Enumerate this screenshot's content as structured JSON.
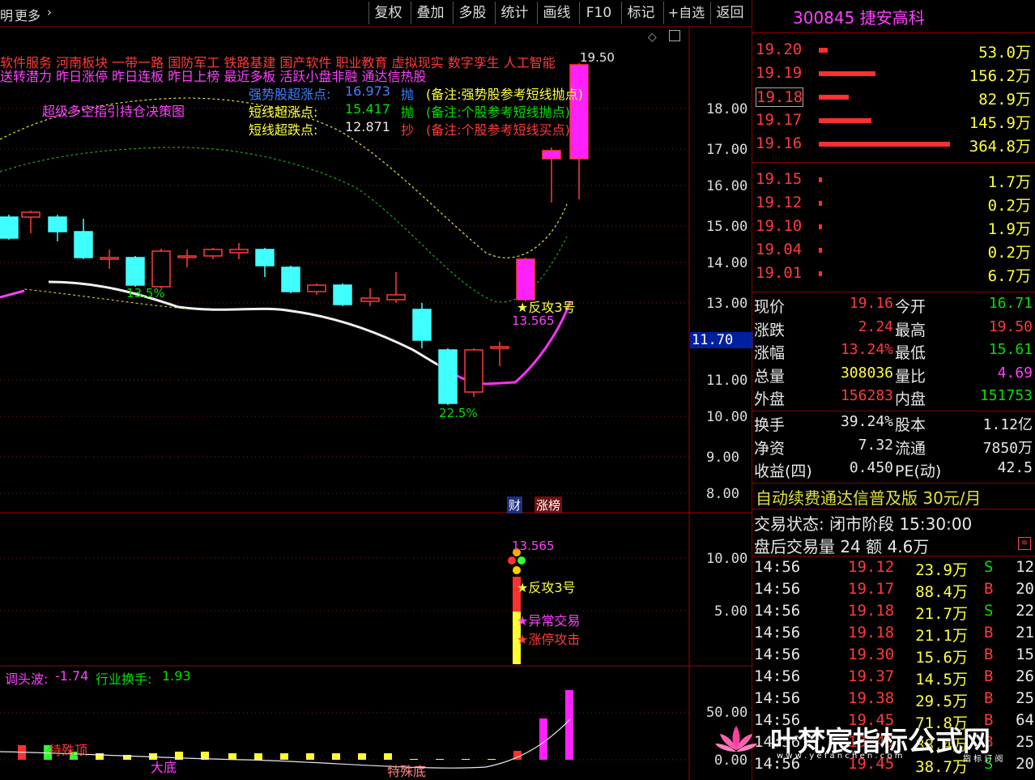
{
  "toolbar": {
    "left": [
      "明",
      "更多"
    ],
    "buttons": [
      "复权",
      "叠加",
      "多股",
      "统计",
      "画线",
      "F10",
      "标记",
      "+自选",
      "返回"
    ]
  },
  "main_overlay": {
    "blocks_line1": "软件服务  河南板块  一带一路 国防军工 铁路基建 国产软件 职业教育 虚拟现实 数字孪生 人工智能",
    "blocks_line2": "送转潜力 昨日涨停 昨日连板 昨日上榜 最近多板 活跃小盘非融 通达信热股",
    "indicator_name": "超级多空指引持仓决策图",
    "rows": [
      {
        "label": "强势股超涨点:",
        "value": "16.973",
        "action": "抛",
        "note": "(备注:强势股参考短线抛点)"
      },
      {
        "label": "短线超涨点:",
        "value": "15.417",
        "action": "抛",
        "note": "(备注:个股参考短线抛点)"
      },
      {
        "label": "短线超跌点:",
        "value": "12.871",
        "action": "抄",
        "note": "(备注:个股参考短线买点)"
      }
    ],
    "high_label": "19.50",
    "pct_labels": [
      "13.5%",
      "22.5%"
    ],
    "signal_label": "★反攻3号",
    "signal_value": "13.565",
    "bottom_tags": [
      "财",
      "涨榜"
    ],
    "current_price_tag": "11.70"
  },
  "main_axis": [
    "18.00",
    "17.00",
    "16.00",
    "15.00",
    "14.00",
    "13.00",
    "11.00",
    "10.00",
    "9.00",
    "8.00"
  ],
  "sub1": {
    "axis": [
      "10.00",
      "5.00"
    ],
    "value": "13.565",
    "signals": [
      "★反攻3号",
      "★异常交易",
      "★涨停攻击"
    ]
  },
  "sub2": {
    "header_a_label": "调头波:",
    "header_a_value": "-1.74",
    "header_b_label": "行业换手:",
    "header_b_value": "1.93",
    "axis": [
      "50.00",
      "0.00"
    ],
    "labels": [
      "特殊顶",
      "大底",
      "特殊底"
    ]
  },
  "quote": {
    "code_name": "300845 捷安高科",
    "asks": [
      {
        "price": "19.20",
        "vol": "53.0万",
        "bar": 0.07
      },
      {
        "price": "19.19",
        "vol": "156.2万",
        "bar": 0.43
      },
      {
        "price": "19.18",
        "vol": "82.9万",
        "bar": 0.23
      },
      {
        "price": "19.17",
        "vol": "145.9万",
        "bar": 0.4
      },
      {
        "price": "19.16",
        "vol": "364.8万",
        "bar": 1.0
      }
    ],
    "bids": [
      {
        "price": "19.15",
        "vol": "1.7万"
      },
      {
        "price": "19.12",
        "vol": "0.2万"
      },
      {
        "price": "19.10",
        "vol": "1.9万"
      },
      {
        "price": "19.04",
        "vol": "0.2万"
      },
      {
        "price": "19.01",
        "vol": "6.7万"
      }
    ],
    "stats": [
      {
        "l1": "现价",
        "v1": "19.16",
        "c1": "red",
        "l2": "今开",
        "v2": "16.71",
        "c2": "green"
      },
      {
        "l1": "涨跌",
        "v1": "2.24",
        "c1": "red",
        "l2": "最高",
        "v2": "19.50",
        "c2": "red"
      },
      {
        "l1": "涨幅",
        "v1": "13.24%",
        "c1": "red",
        "l2": "最低",
        "v2": "15.61",
        "c2": "green"
      },
      {
        "l1": "总量",
        "v1": "308036",
        "c1": "yellow",
        "l2": "量比",
        "v2": "4.69",
        "c2": "mag"
      },
      {
        "l1": "外盘",
        "v1": "156283",
        "c1": "red",
        "l2": "内盘",
        "v2": "151753",
        "c2": "green"
      }
    ],
    "stats2": [
      {
        "l1": "换手",
        "v1": "39.24%",
        "l2": "股本",
        "v2": "1.12亿"
      },
      {
        "l1": "净资",
        "v1": "7.32",
        "l2": "流通",
        "v2": "7850万"
      },
      {
        "l1": "收益(四)",
        "v1": "0.450",
        "l2": "PE(动)",
        "v2": "42.5"
      }
    ],
    "promo": "自动续费通达信普及版  30元/月",
    "trade_status": "交易状态: 闭市阶段 15:30:00",
    "after_hours": "盘后交易量 24 额 4.6万",
    "ticks": [
      {
        "t": "14:56",
        "p": "19.12",
        "v": "23.9万",
        "bs": "S",
        "n": "12"
      },
      {
        "t": "14:56",
        "p": "19.17",
        "v": "88.4万",
        "bs": "B",
        "n": "20"
      },
      {
        "t": "14:56",
        "p": "19.18",
        "v": "21.7万",
        "bs": "S",
        "n": "22"
      },
      {
        "t": "14:56",
        "p": "19.18",
        "v": "21.1万",
        "bs": "B",
        "n": "21"
      },
      {
        "t": "14:56",
        "p": "19.30",
        "v": "15.6万",
        "bs": "B",
        "n": "15"
      },
      {
        "t": "14:56",
        "p": "19.37",
        "v": "14.5万",
        "bs": "B",
        "n": "26"
      },
      {
        "t": "14:56",
        "p": "19.38",
        "v": "29.5万",
        "bs": "B",
        "n": "25"
      },
      {
        "t": "14:56",
        "p": "19.45",
        "v": "71.8万",
        "bs": "B",
        "n": "64"
      },
      {
        "t": "14:56",
        "p": "19.45",
        "v": "88.4万",
        "bs": "B",
        "n": "25"
      },
      {
        "t": "14:56",
        "p": "19.45",
        "v": "38.7万",
        "bs": "S",
        "n": "20"
      }
    ]
  },
  "watermark": {
    "title": "叶梵宸指标公式网",
    "url": "w w w . y e f a n c h e n . c o m",
    "sub": "指 标 订 阅"
  },
  "colors": {
    "up": "#ff3a3a",
    "down": "#40ffff",
    "axis_border": "#a00000"
  }
}
